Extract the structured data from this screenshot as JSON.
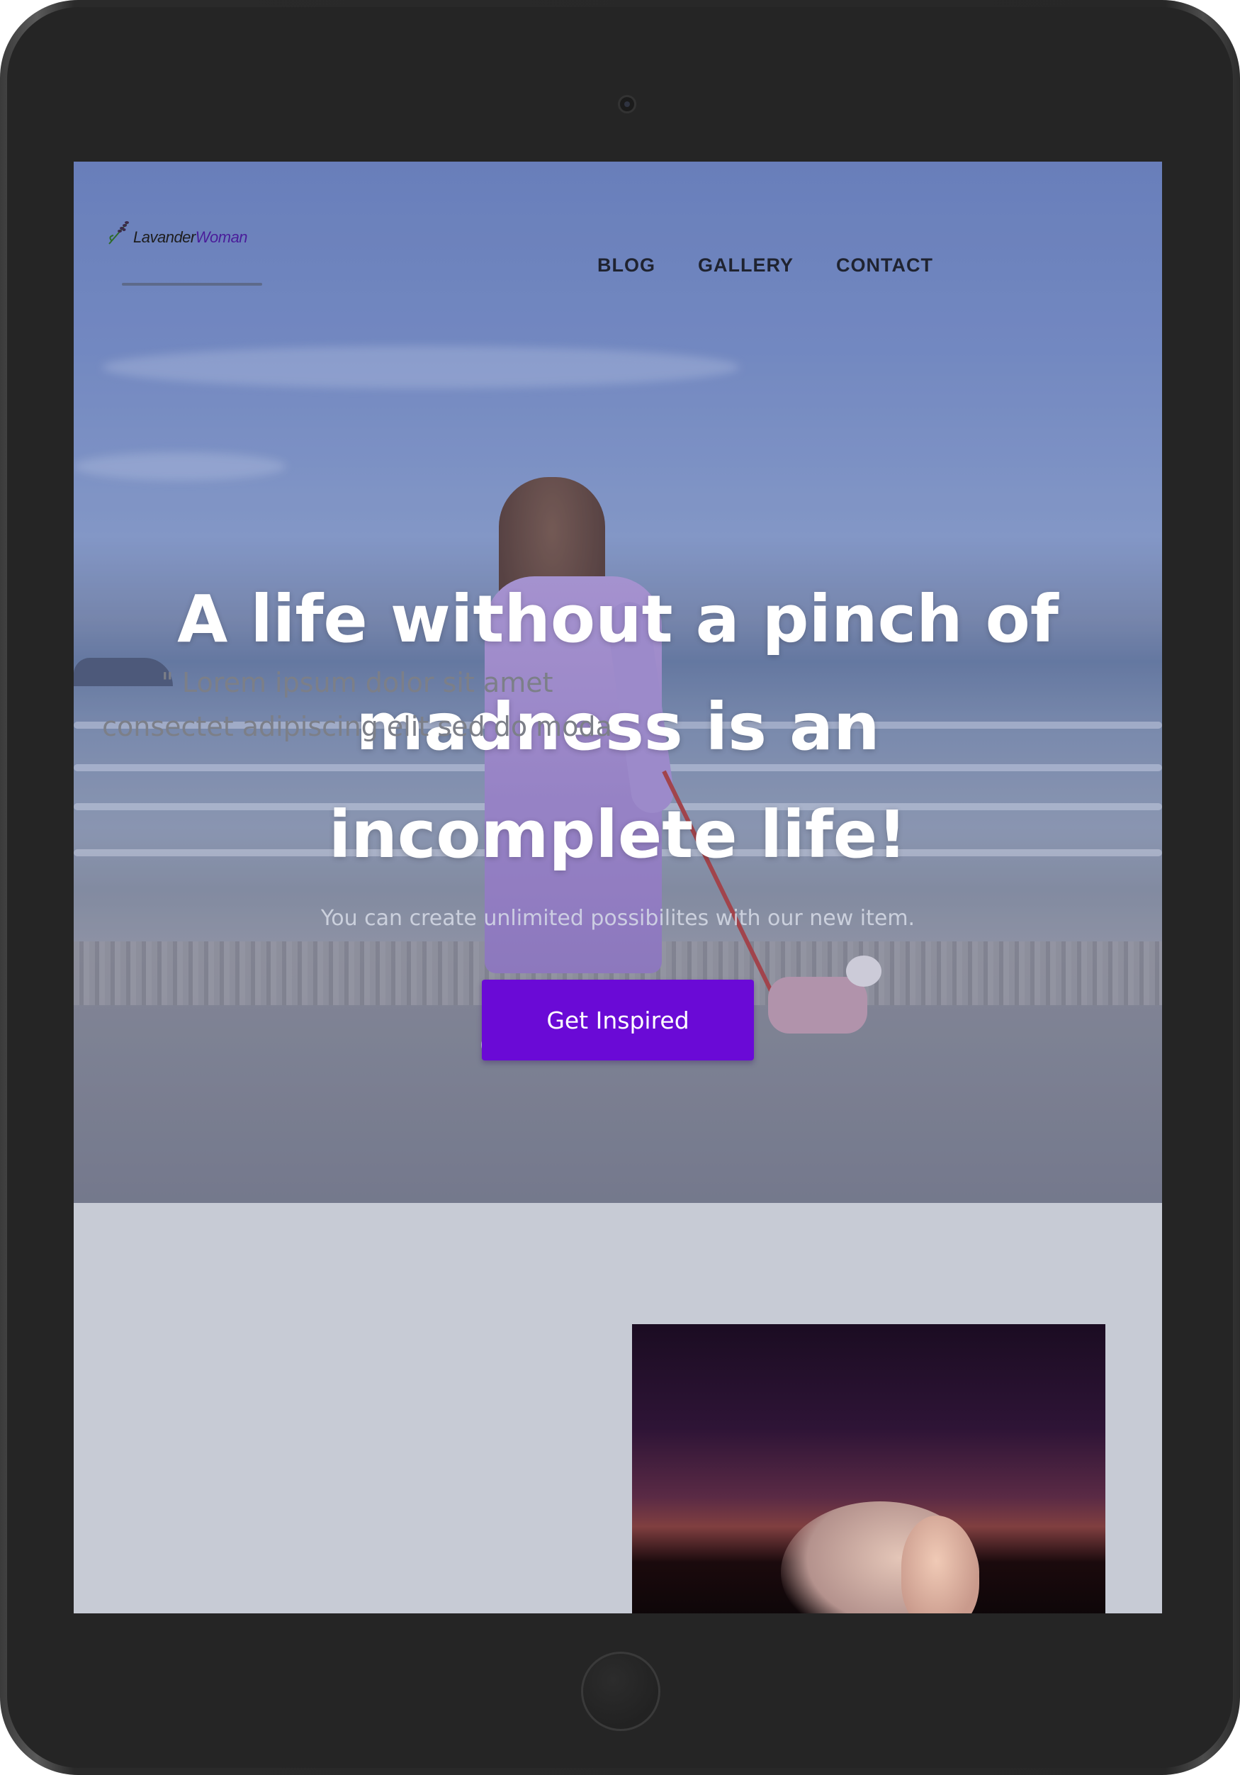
{
  "logo": {
    "word1": "Lavander",
    "word2": "Woman"
  },
  "nav": {
    "items": [
      {
        "label": "BLOG"
      },
      {
        "label": "GALLERY"
      },
      {
        "label": "CONTACT"
      }
    ]
  },
  "hero": {
    "headline": "A life without a pinch of madness is an incomplete life!",
    "subtext": "You can create unlimited possibilites with our new item.",
    "cta_label": "Get Inspired"
  },
  "lower": {
    "quote": "\" Lorem ipsum dolor sit amet consectet adipiscing elit sed do moda"
  },
  "colors": {
    "accent": "#6a0ad6",
    "brand_purple": "#4a1d9a",
    "section_bg": "#c7cbd5"
  }
}
